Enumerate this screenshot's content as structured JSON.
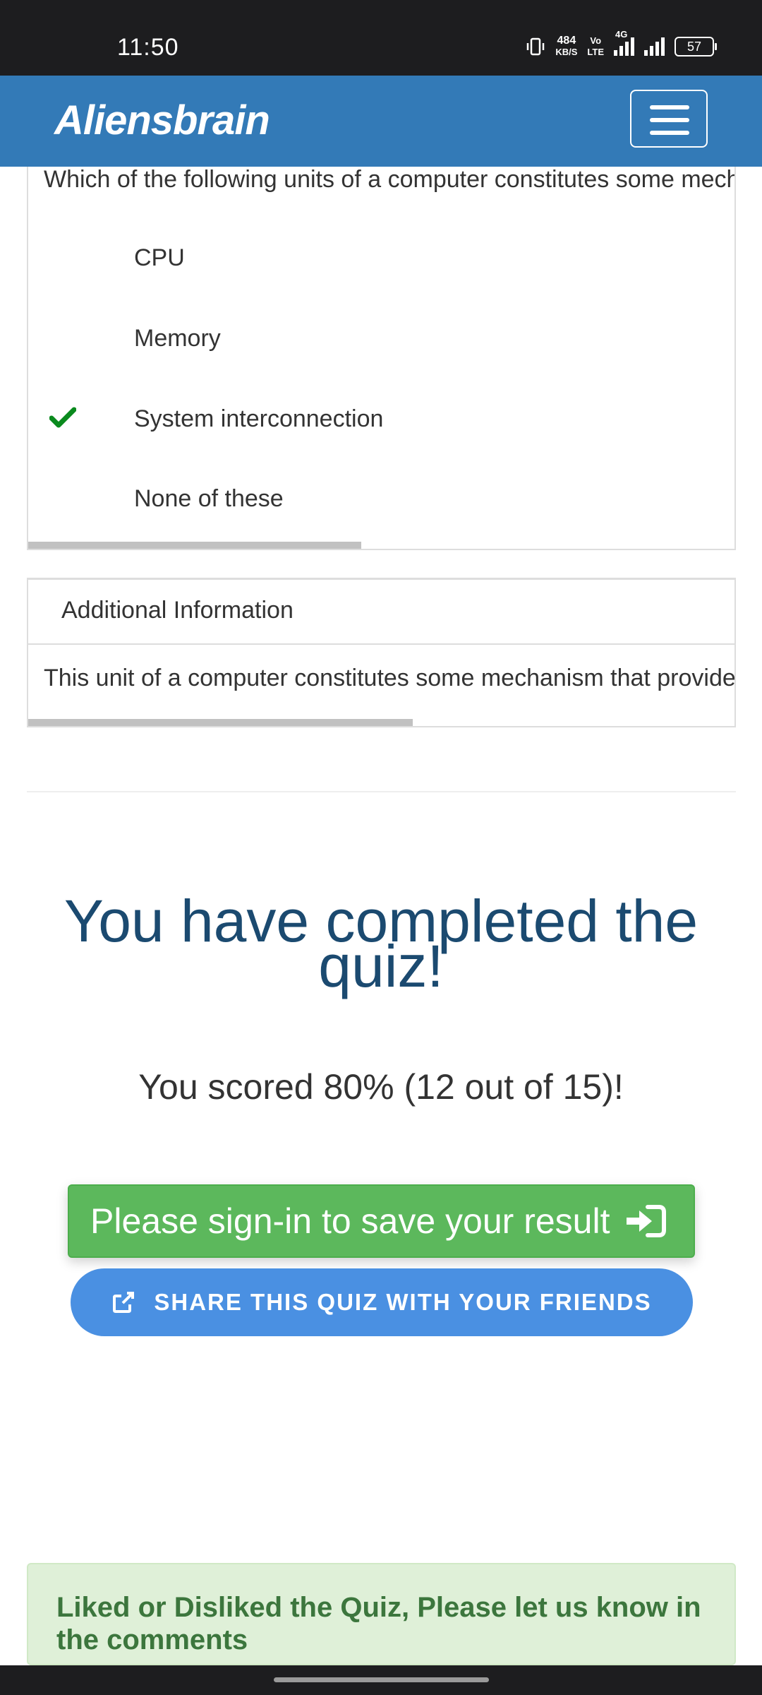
{
  "status_bar": {
    "time": "11:50",
    "net_speed_value": "484",
    "net_speed_unit": "KB/S",
    "volte_top": "Vo",
    "volte_bottom": "LTE",
    "network": "4G",
    "battery": "57"
  },
  "navbar": {
    "brand": "Aliensbrain",
    "menu_icon": "hamburger-menu-icon"
  },
  "question": {
    "text": "Which of the following units of a computer constitutes some mechanism that provides for communication among CPU, main memory and I/O?",
    "answers": [
      {
        "label": "CPU",
        "selected": false
      },
      {
        "label": "Memory",
        "selected": false
      },
      {
        "label": "System interconnection",
        "selected": true
      },
      {
        "label": "None of these",
        "selected": false
      }
    ],
    "correct_icon": "check-icon",
    "correct_color": "#0a8a1e"
  },
  "additional": {
    "heading": "Additional Information",
    "body": "This unit of a computer constitutes some mechanism that provides for communication among CPU, main memory and I/O."
  },
  "result": {
    "completed": "You have completed the quiz!",
    "score": "You scored 80% (12 out of 15)!",
    "score_percent": 80
  },
  "actions": {
    "signin_label": "Please sign-in to save your result",
    "signin_icon": "sign-in-icon",
    "share_label": "SHARE THIS QUIZ WITH YOUR FRIENDS",
    "share_icon": "share-icon"
  },
  "feedback": {
    "text": "Liked or Disliked the Quiz, Please let us know in the comments"
  },
  "colors": {
    "navbar": "#337ab7",
    "success": "#5cb85c",
    "share": "#4a90e2",
    "title": "#1b4a70"
  }
}
